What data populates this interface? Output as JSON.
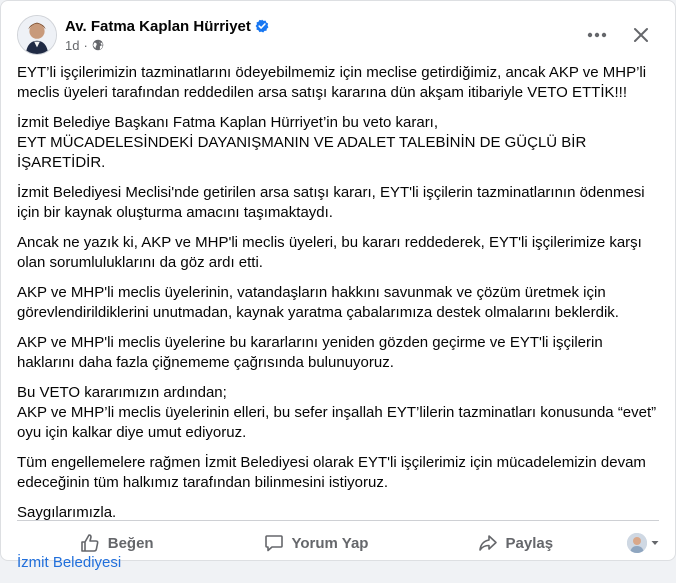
{
  "post": {
    "author": "Av. Fatma Kaplan Hürriyet",
    "time": "1d",
    "paragraphs": [
      "EYT’li işçilerimizin tazminatlarını ödeyebilmemiz için meclise getirdiğimiz, ancak AKP ve MHP’li meclis üyeleri tarafından reddedilen arsa satışı kararına dün akşam itibariyle  VETO ETTİK!!!",
      "İzmit Belediye Başkanı Fatma Kaplan Hürriyet’in bu veto kararı,\nEYT MÜCADELESİNDEKİ DAYANIŞMANIN VE ADALET TALEBİNİN DE GÜÇLÜ BİR İŞARETİDİR.",
      "İzmit Belediyesi Meclisi'nde getirilen arsa satışı kararı, EYT'li işçilerin tazminatlarının ödenmesi için bir kaynak oluşturma amacını taşımaktaydı.",
      "Ancak ne yazık ki, AKP ve MHP'li meclis üyeleri, bu kararı reddederek, EYT'li işçilerimize karşı olan sorumluluklarını da göz ardı etti.",
      "AKP ve MHP'li meclis üyelerinin, vatandaşların hakkını savunmak ve çözüm üretmek için görevlendirildiklerini unutmadan, kaynak yaratma çabalarımıza destek olmalarını beklerdik.",
      "AKP ve MHP'li meclis üyelerine bu kararlarını yeniden gözden geçirme ve EYT'li işçilerin haklarını daha fazla çiğnememe çağrısında bulunuyoruz.",
      "Bu VETO kararımızın ardından;\nAKP ve MHP’li meclis üyelerinin elleri, bu sefer inşallah EYT’lilerin tazminatları konusunda “evet” oyu için kalkar diye umut ediyoruz.",
      "Tüm engellemelere rağmen İzmit Belediyesi olarak EYT'li işçilerimiz için mücadelemizin devam edeceğinin tüm halkımız tarafından bilinmesini istiyoruz.",
      "Saygılarımızla."
    ],
    "tag": "İzmit Belediyesi"
  },
  "actions": {
    "like": "Beğen",
    "comment": "Yorum Yap",
    "share": "Paylaş"
  },
  "colors": {
    "verified": "#1877f2",
    "link": "#216fdb",
    "secondary_text": "#65676b"
  },
  "icons": [
    "verified-badge-icon",
    "globe-icon",
    "more-options-icon",
    "close-icon",
    "like-icon",
    "comment-icon",
    "share-icon",
    "chevron-down-icon"
  ]
}
